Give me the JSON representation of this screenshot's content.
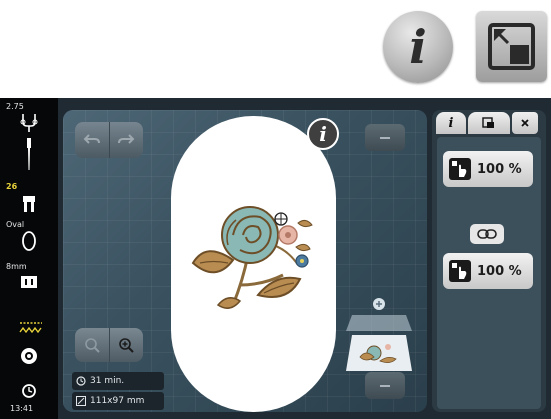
{
  "top_callouts": {
    "info_label": "i"
  },
  "left_status": {
    "needle_value": "2.75",
    "presser_foot_value": "26",
    "hoop_label": "Oval",
    "thickness_label": "8mm",
    "time": "13:41"
  },
  "main": {
    "info_label": "i",
    "time_estimate": "31 min.",
    "design_size": "111x97 mm"
  },
  "right_panel": {
    "scale_width": "100 %",
    "scale_height": "100 %"
  },
  "colors": {
    "accent_yellow": "#e8d23b",
    "screen_bg": "#1f2a33",
    "panel_bg": "#2b3a43"
  }
}
